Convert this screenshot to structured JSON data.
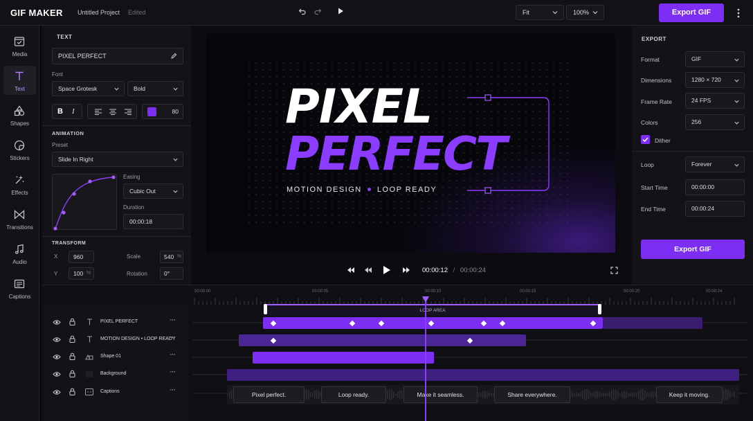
{
  "app": {
    "brand": "GIF MAKER",
    "project": "Untitled Project",
    "status": "Edited"
  },
  "toolbar": {
    "fit": "Fit",
    "zoom": "100%",
    "export": "Export GIF"
  },
  "rail": [
    {
      "label": "Media",
      "icon": "media-icon"
    },
    {
      "label": "Text",
      "icon": "text-icon"
    },
    {
      "label": "Shapes",
      "icon": "shapes-icon"
    },
    {
      "label": "Stickers",
      "icon": "stickers-icon"
    },
    {
      "label": "Effects",
      "icon": "effects-icon"
    },
    {
      "label": "Transitions",
      "icon": "transitions-icon"
    },
    {
      "label": "Audio",
      "icon": "audio-icon"
    },
    {
      "label": "Captions",
      "icon": "captions-icon"
    }
  ],
  "text_panel": {
    "title": "TEXT",
    "value": "PIXEL PERFECT",
    "font_label": "Font",
    "font": "Space Grotesk",
    "weight": "Bold",
    "color": "#7c2ef5",
    "opacity": "80",
    "animation_title": "ANIMATION",
    "preset_label": "Preset",
    "preset": "Slide In Right",
    "easing_label": "Easing",
    "easing": "Cubic Out",
    "duration_label": "Duration",
    "duration": "00:00:18",
    "transform_title": "TRANSFORM",
    "x_label": "X",
    "x": "960",
    "y_label": "Y",
    "y": "100",
    "y_unit": "%",
    "scale_label": "Scale",
    "scale": "540",
    "scale_unit": "%",
    "rotation_label": "Rotation",
    "rotation": "0°"
  },
  "stage": {
    "line1": "PIXEL",
    "line2": "PERFECT",
    "tagline_a": "MOTION DESIGN",
    "tagline_b": "LOOP READY"
  },
  "player": {
    "current": "00:00:12",
    "sep": "/",
    "total": "00:00:24"
  },
  "export_panel": {
    "title": "EXPORT",
    "format_label": "Format",
    "format": "GIF",
    "dimensions_label": "Dimensions",
    "dimensions": "1280 × 720",
    "frame_rate_label": "Frame Rate",
    "frame_rate": "24 FPS",
    "colors_label": "Colors",
    "colors": "256",
    "dither_label": "Dither",
    "dither": true,
    "loop_label": "Loop",
    "loop": "Forever",
    "start_label": "Start Time",
    "start": "00:00:00",
    "end_label": "End Time",
    "end": "00:00:24",
    "button": "Export GIF"
  },
  "timeline": {
    "ticks": [
      "00:00:00",
      "00:00:05",
      "00:00:10",
      "00:00:15",
      "00:00:20",
      "00:00:24"
    ],
    "loop_label": "LOOP AREA",
    "tracks": [
      {
        "name": "PIXEL PERFECT",
        "icon": "text-track-icon"
      },
      {
        "name": "MOTION DESIGN • LOOP READY",
        "icon": "text-track-icon"
      },
      {
        "name": "Shape 01",
        "icon": "shape-track-icon"
      },
      {
        "name": "Background",
        "icon": "background-track-icon"
      },
      {
        "name": "Captions",
        "icon": "captions-track-icon"
      }
    ],
    "captions": [
      "Pixel perfect.",
      "Loop ready.",
      "Make it seamless.",
      "Share everywhere.",
      "Keep it moving."
    ]
  },
  "colors": {
    "accent": "#7c2ef5",
    "accent_light": "#a45cff",
    "panel": "#131317"
  }
}
